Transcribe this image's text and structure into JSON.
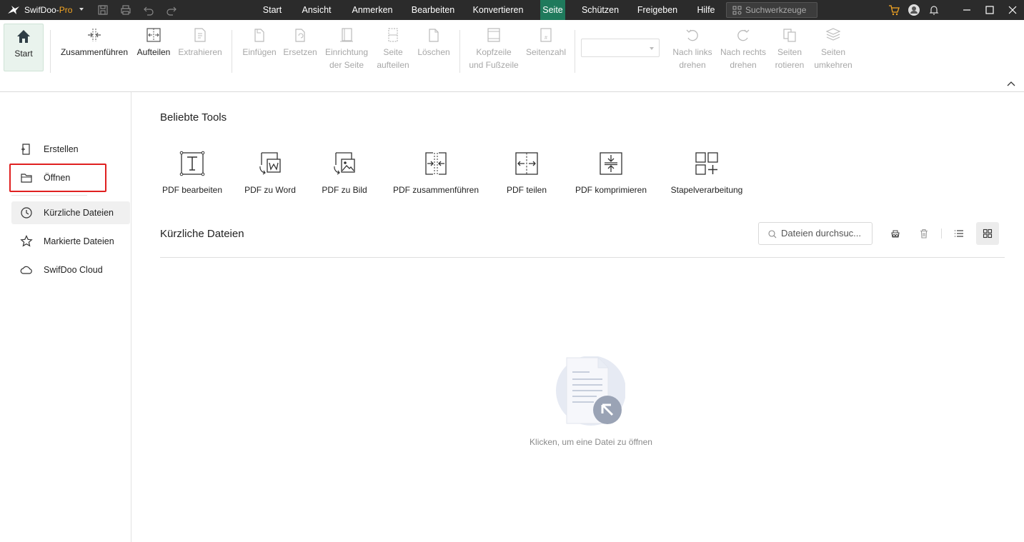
{
  "app": {
    "name": "SwifDoo-",
    "edition": "Pro"
  },
  "menu": [
    "Start",
    "Ansicht",
    "Anmerken",
    "Bearbeiten",
    "Konvertieren",
    "Seite",
    "Schützen",
    "Freigeben",
    "Hilfe"
  ],
  "active_menu": "Seite",
  "tool_search": {
    "placeholder": "Suchwerkzeuge"
  },
  "ribbon": {
    "start": "Start",
    "merge": "Zusammenführen",
    "split": "Aufteilen",
    "extract": "Extrahieren",
    "insert": "Einfügen",
    "replace": "Ersetzen",
    "page_setup": [
      "Einrichtung",
      "der Seite"
    ],
    "split_pages": [
      "Seite",
      "aufteilen"
    ],
    "delete": "Löschen",
    "header_footer": [
      "Kopfzeile",
      "und Fußzeile"
    ],
    "page_number": "Seitenzahl",
    "rotate_left": [
      "Nach links",
      "drehen"
    ],
    "rotate_right": [
      "Nach rechts",
      "drehen"
    ],
    "rotate_pages": [
      "Seiten",
      "rotieren"
    ],
    "reverse_pages": [
      "Seiten",
      "umkehren"
    ]
  },
  "sidebar": {
    "create": "Erstellen",
    "open": "Öffnen",
    "recent": "Kürzliche Dateien",
    "starred": "Markierte Dateien",
    "cloud": "SwifDoo Cloud"
  },
  "popular_tools": {
    "title": "Beliebte Tools",
    "items": [
      "PDF bearbeiten",
      "PDF zu Word",
      "PDF zu Bild",
      "PDF zusammenführen",
      "PDF teilen",
      "PDF komprimieren",
      "Stapelverarbeitung"
    ]
  },
  "recent_files": {
    "title": "Kürzliche Dateien",
    "search_placeholder": "Dateien durchsuc...",
    "empty_text": "Klicken, um eine Datei zu öffnen"
  },
  "colors": {
    "titlebar": "#2b2b2b",
    "active_menu": "#1f7a5c",
    "accent": "#f5a623",
    "highlight": "#e02020"
  }
}
